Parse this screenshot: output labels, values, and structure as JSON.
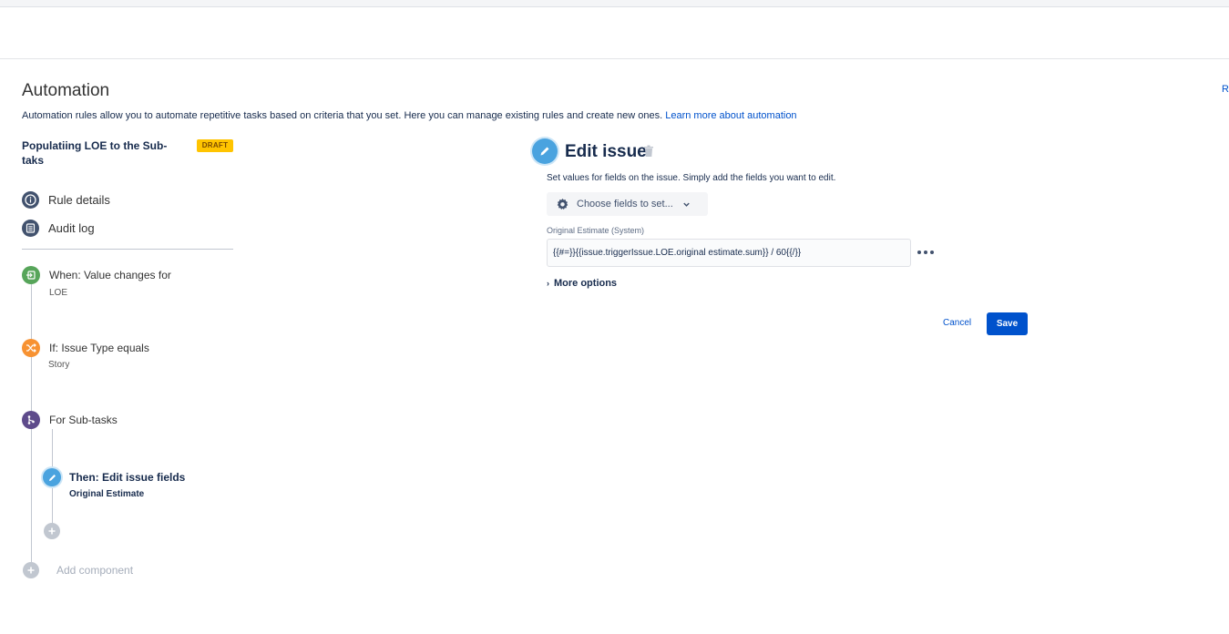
{
  "page": {
    "title": "Automation",
    "description": "Automation rules allow you to automate repetitive tasks based on criteria that you set. Here you can manage existing rules and create new ones.",
    "learn_more": "Learn more about automation",
    "edge_link": "R"
  },
  "rule": {
    "name": "Populatiing LOE to the Sub-taks",
    "status_badge": "DRAFT",
    "nav": [
      {
        "label": "Rule details",
        "icon": "info-icon"
      },
      {
        "label": "Audit log",
        "icon": "list-icon"
      }
    ]
  },
  "components": {
    "trigger": {
      "title": "When: Value changes for",
      "subtitle": "LOE",
      "icon": "trigger-icon",
      "color": "#57a55a"
    },
    "condition": {
      "title": "If: Issue Type equals",
      "subtitle": "Story",
      "icon": "shuffle-icon",
      "color": "#f79232"
    },
    "branch": {
      "title": "For Sub-tasks",
      "icon": "branch-icon",
      "color": "#5e4b8b"
    },
    "action": {
      "title": "Then: Edit issue fields",
      "subtitle": "Original Estimate",
      "icon": "pencil-icon",
      "color": "#4aa3df"
    },
    "add_component": "Add component"
  },
  "editor": {
    "title": "Edit issue",
    "description": "Set values for fields on the issue. Simply add the fields you want to edit.",
    "choose_fields": "Choose fields to set...",
    "field_label": "Original Estimate (System)",
    "field_value": "{{#=}}{{issue.triggerIssue.LOE.original estimate.sum}} / 60{{/}}",
    "more_options": "More options",
    "cancel": "Cancel",
    "save": "Save"
  },
  "colors": {
    "primary": "#0052cc",
    "draft_badge": "#ffc400"
  }
}
